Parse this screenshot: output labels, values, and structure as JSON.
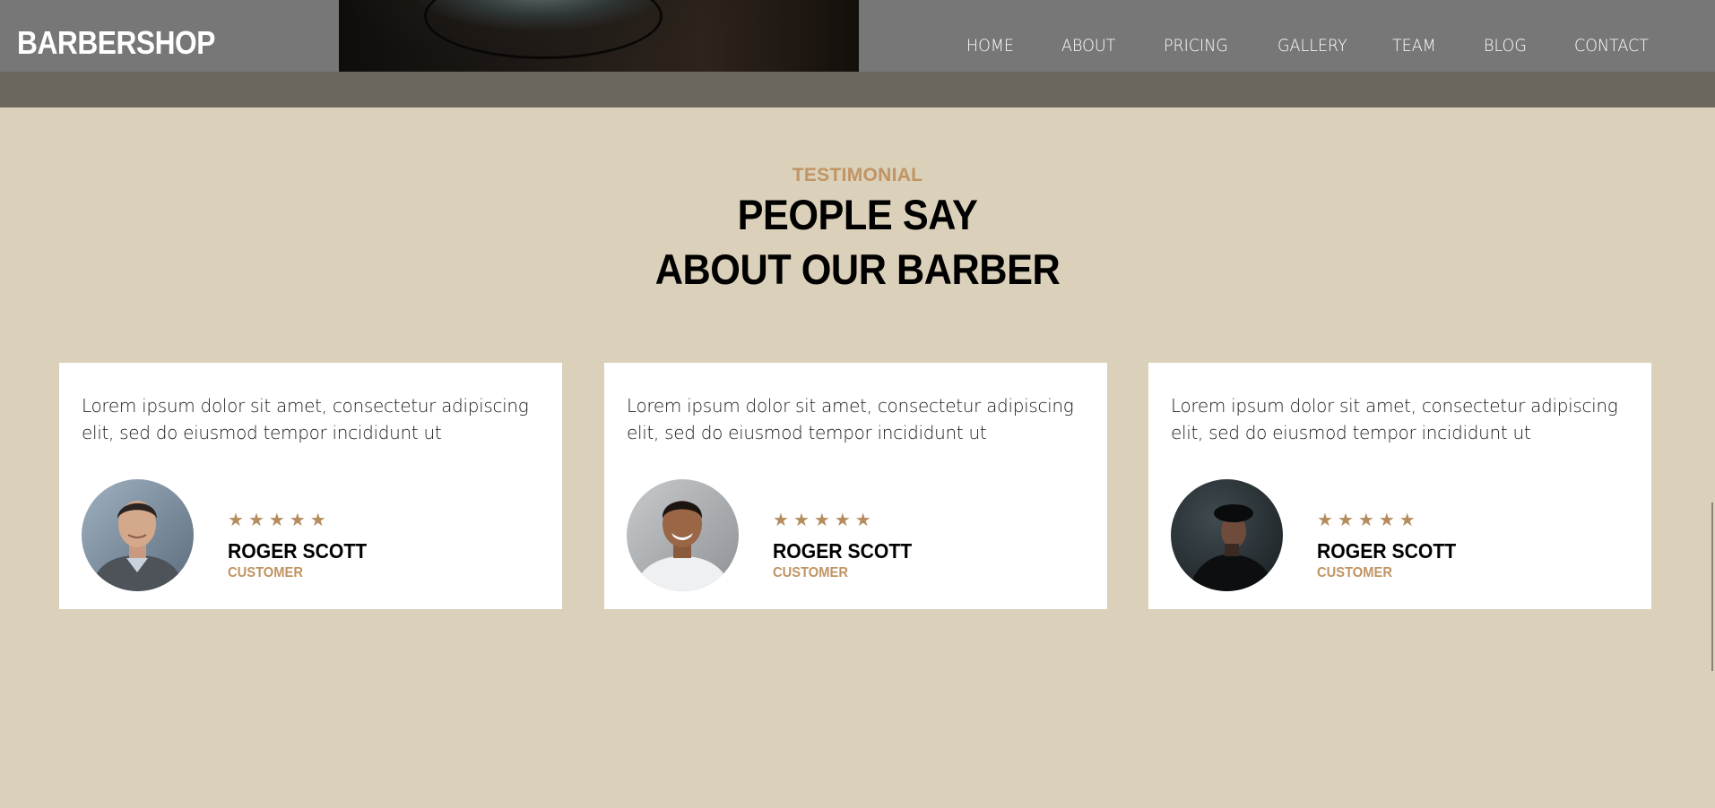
{
  "header": {
    "brand": "BARBERSHOP",
    "nav": [
      "HOME",
      "ABOUT",
      "PRICING",
      "GALLERY",
      "TEAM",
      "BLOG",
      "CONTACT"
    ]
  },
  "testimonial_section": {
    "eyebrow": "TESTIMONIAL",
    "title_line1": "PEOPLE SAY",
    "title_line2": "ABOUT OUR BARBER",
    "cards": [
      {
        "text": "Lorem ipsum dolor sit amet, consectetur adipiscing elit, sed do eiusmod tempor incididunt ut",
        "rating": 5,
        "name": "ROGER SCOTT",
        "role": "CUSTOMER"
      },
      {
        "text": "Lorem ipsum dolor sit amet, consectetur adipiscing elit, sed do eiusmod tempor incididunt ut",
        "rating": 5,
        "name": "ROGER SCOTT",
        "role": "CUSTOMER"
      },
      {
        "text": "Lorem ipsum dolor sit amet, consectetur adipiscing elit, sed do eiusmod tempor incididunt ut",
        "rating": 5,
        "name": "ROGER SCOTT",
        "role": "CUSTOMER"
      }
    ]
  },
  "colors": {
    "page_background": "#dbd0b9",
    "accent": "#c09464",
    "star": "#b48c5e",
    "header_background": "#787878",
    "card_background": "#ffffff"
  },
  "icons": {
    "rating": "star-icon"
  }
}
